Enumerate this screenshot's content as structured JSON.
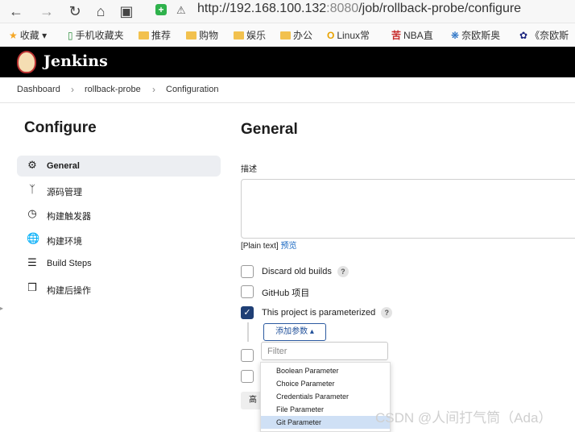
{
  "browser": {
    "url_host": "http://192.168.100.132",
    "url_port": ":8080",
    "url_path": "/job/rollback-probe/configure",
    "bookmarks": [
      "收藏",
      "手机收藏夹",
      "推荐",
      "购物",
      "娱乐",
      "办公",
      "Linux常",
      "NBA直",
      "奈欧斯奥",
      "《奈欧斯"
    ]
  },
  "jenkins": {
    "title": "Jenkins"
  },
  "breadcrumb": [
    "Dashboard",
    "rollback-probe",
    "Configuration"
  ],
  "sidebar": {
    "title": "Configure",
    "items": [
      {
        "label": "General",
        "icon": "gear-icon"
      },
      {
        "label": "源码管理",
        "icon": "branch-icon"
      },
      {
        "label": "构建触发器",
        "icon": "clock-icon"
      },
      {
        "label": "构建环境",
        "icon": "globe-icon"
      },
      {
        "label": "Build Steps",
        "icon": "list-icon"
      },
      {
        "label": "构建后操作",
        "icon": "cube-icon"
      }
    ]
  },
  "main": {
    "title": "General",
    "description_label": "描述",
    "plain_text": "[Plain text]",
    "preview": "预览",
    "options": [
      {
        "label": "Discard old builds",
        "checked": false,
        "help": "?"
      },
      {
        "label": "GitHub 项目",
        "checked": false
      },
      {
        "label": "This project is parameterized",
        "checked": true,
        "help": "?"
      }
    ],
    "add_param_button": "添加参数",
    "filter_placeholder": "Filter",
    "advanced_button": "高级",
    "param_menu": [
      "Boolean Parameter",
      "Choice Parameter",
      "Credentials Parameter",
      "File Parameter",
      "Git Parameter"
    ],
    "param_menu_active_index": 4
  },
  "watermark": "CSDN @人间打气筒（Ada）"
}
